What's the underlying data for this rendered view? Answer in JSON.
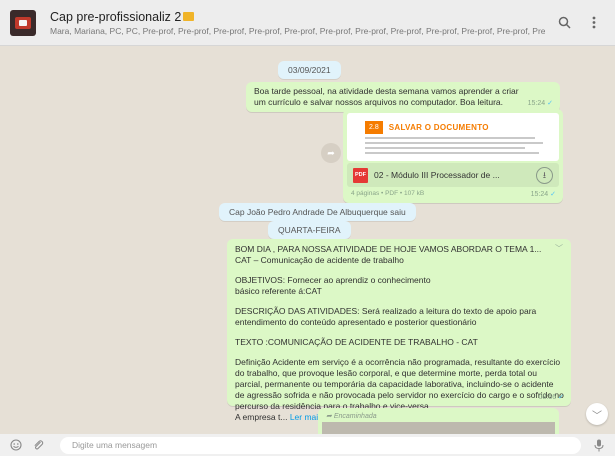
{
  "header": {
    "title": "Cap pre-profissionaliz 2",
    "subtitle": "Mara, Mariana, PC, PC, Pre-prof, Pre-prof, Pre-prof, Pre-prof, Pre-prof, Pre-prof, Pre-prof, Pre-prof, Pre-prof, Pre-prof, Pre-prof, Pre-prof, Pre-prof..."
  },
  "chat": {
    "date_chip": "03/09/2021",
    "message1": {
      "text": "Boa tarde pessoal, na atividade desta semana vamos aprender a criar um currículo e salvar nossos arquivos no computador. Boa leitura.",
      "time": "15:24"
    },
    "document": {
      "banner_number": "2.8",
      "banner_title": "SALVAR O DOCUMENTO",
      "file_type": "PDF",
      "file_name": "02 - Módulo III Processador de ...",
      "meta": "4 páginas • PDF • 107 kB",
      "time": "15:24"
    },
    "system_notice": "Cap João Pedro Andrade De Albuquerque saiu",
    "day_chip": "QUARTA-FEIRA",
    "message2": {
      "p1": "BOM DIA , PARA NOSSA ATIVIDADE DE HOJE VAMOS ABORDAR O TEMA 1... CAT – Comunicação de acidente de trabalho",
      "p2": "OBJETIVOS: Fornecer ao aprendiz o conhecimento básico referente á:CAT",
      "p3": "DESCRIÇÃO DAS ATIVIDADES: Será realizado a leitura do texto de apoio para entendimento do conteúdo apresentado e posterior questionário",
      "p4": "TEXTO :COMUNICAÇÃO DE ACIDENTE DE TRABALHO - CAT",
      "p5": "Definição Acidente em serviço é a ocorrência não programada, resultante do exercício do trabalho, que provoque lesão corporal, e que determine morte, perda total ou parcial, permanente ou temporária da capacidade laborativa, incluindo-se o acidente de agressão sofrida e não provocada pelo servidor no exercício do cargo e o sofrido no percurso da residência para o trabalho e vice-versa.",
      "p6": "A empresa t...",
      "read_more": "Ler mais",
      "time": "08:56"
    },
    "forwarded_label": "Encaminhada"
  },
  "footer": {
    "placeholder": "Digite uma mensagem"
  }
}
